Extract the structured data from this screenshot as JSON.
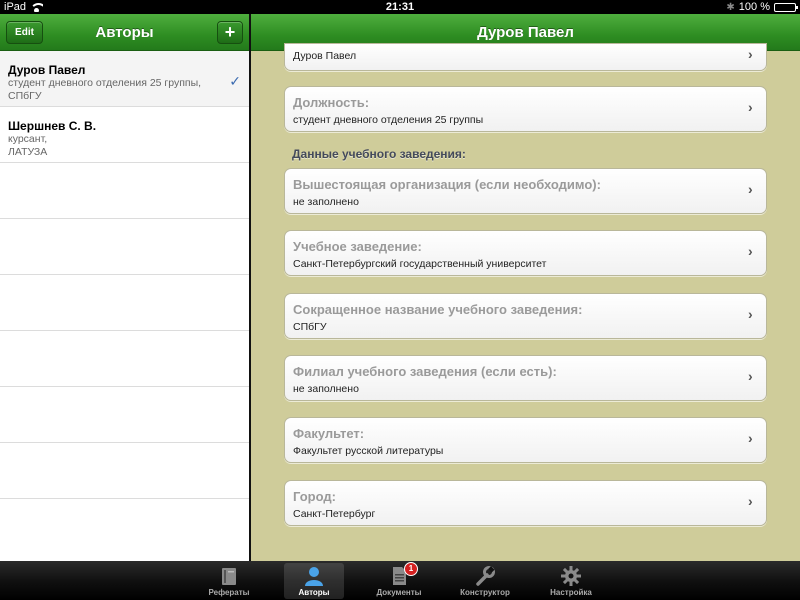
{
  "status_bar": {
    "device": "iPad",
    "time": "21:31",
    "battery": "100 %"
  },
  "left_pane": {
    "title": "Авторы",
    "edit_label": "Edit",
    "add_label": "+",
    "rows": [
      {
        "name": "Дуров Павел",
        "sub1": "студент дневного отделения 25 группы,",
        "sub2": "СПбГУ",
        "selected": true
      },
      {
        "name": "Шершнев С. В.",
        "sub1": "курсант,",
        "sub2": "ЛАТУЗА",
        "selected": false
      }
    ],
    "check_mark": "✓"
  },
  "right_pane": {
    "title": "Дуров Павел",
    "top_value": "Дуров Павел",
    "position_label": "Должность:",
    "position_value": "студент дневного отделения 25 группы",
    "section_header": "Данные учебного заведения:",
    "fields": [
      {
        "label": "Вышестоящая организация (если необходимо):",
        "value": "не заполнено"
      },
      {
        "label": "Учебное заведение:",
        "value": "Санкт-Петербургский государственный университет"
      },
      {
        "label": "Сокращенное название учебного заведения:",
        "value": "СПбГУ"
      },
      {
        "label": "Филиал учебного заведения (если есть):",
        "value": "не заполнено"
      },
      {
        "label": "Факультет:",
        "value": "Факультет русской литературы"
      },
      {
        "label": "Город:",
        "value": "Санкт-Петербург"
      }
    ]
  },
  "tab_bar": {
    "tabs": [
      {
        "label": "Рефераты",
        "icon": "book-icon"
      },
      {
        "label": "Авторы",
        "icon": "person-icon",
        "active": true
      },
      {
        "label": "Документы",
        "icon": "document-icon",
        "badge": "1"
      },
      {
        "label": "Конструктор",
        "icon": "wrench-icon"
      },
      {
        "label": "Настройка",
        "icon": "gear-icon"
      }
    ]
  },
  "colors": {
    "nav_green": "#2e8d22",
    "detail_background": "#cfcc9a",
    "badge_red": "#d42020"
  }
}
